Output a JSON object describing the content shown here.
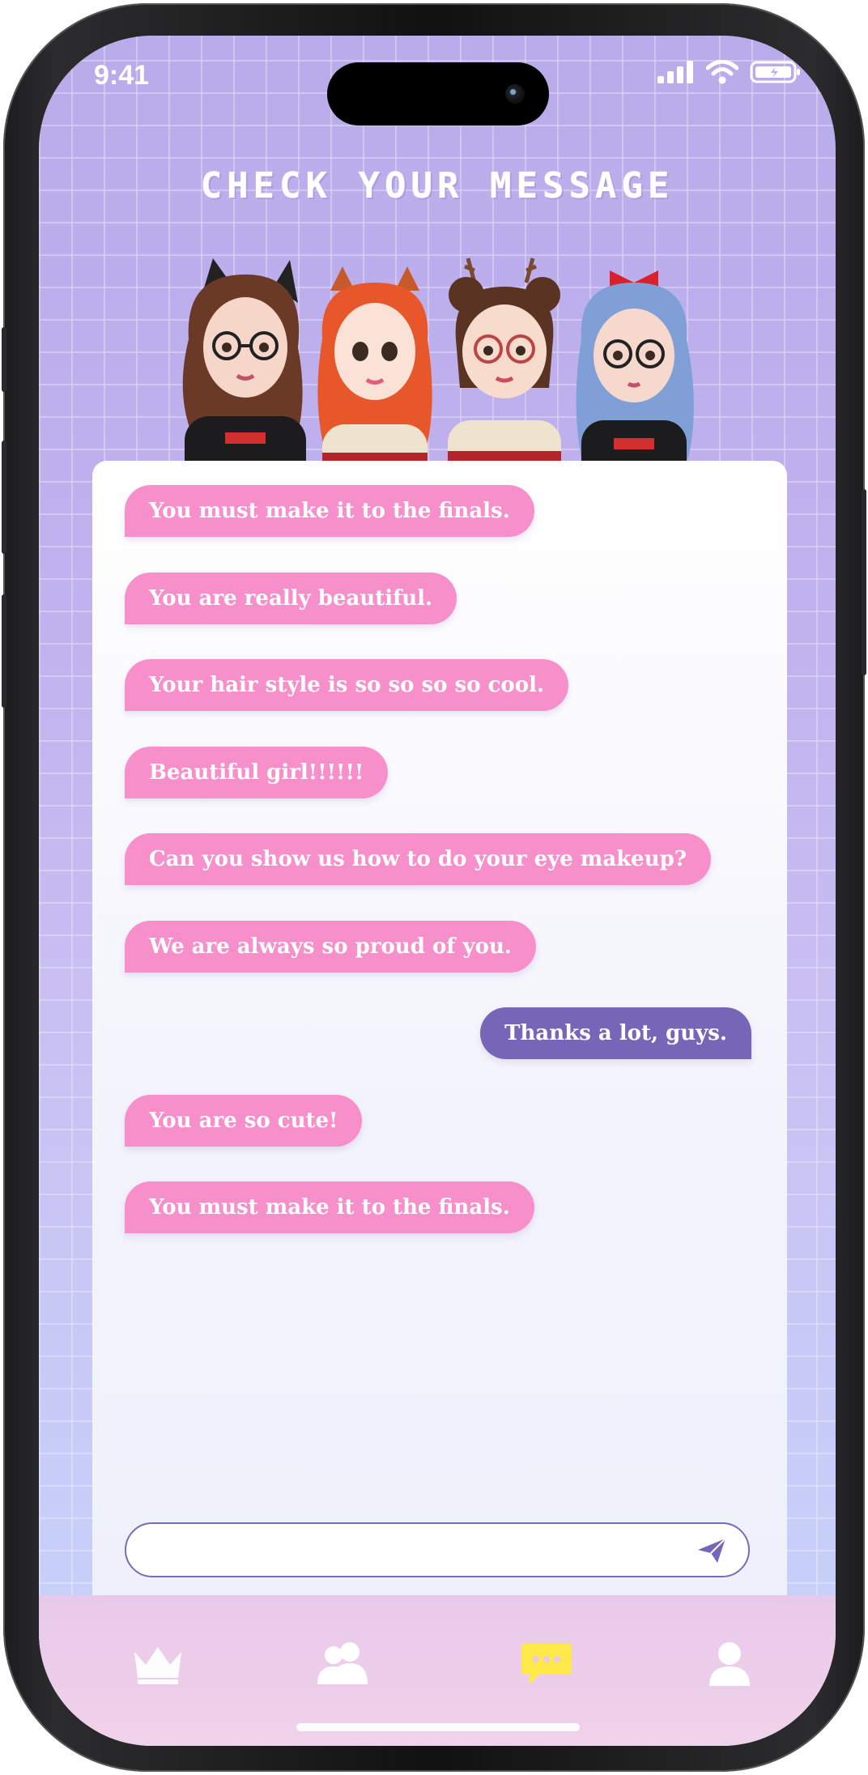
{
  "status_bar": {
    "time": "9:41"
  },
  "header": {
    "title": "CHECK YOUR MESSAGE"
  },
  "avatars": [
    "girl-cat-ears-glasses",
    "girl-fox-ears-red-hair",
    "girl-reindeer-ears-buns",
    "girl-blue-hair-red-bow"
  ],
  "messages": [
    {
      "text": "You must make it to the finals.",
      "direction": "incoming"
    },
    {
      "text": "You are really beautiful.",
      "direction": "incoming"
    },
    {
      "text": "Your hair style is so so so so cool.",
      "direction": "incoming"
    },
    {
      "text": "Beautiful girl!!!!!!",
      "direction": "incoming"
    },
    {
      "text": "Can you show us how to do your eye makeup?",
      "direction": "incoming"
    },
    {
      "text": "We are always so proud of you.",
      "direction": "incoming"
    },
    {
      "text": "Thanks a lot, guys.",
      "direction": "outgoing"
    },
    {
      "text": "You are so cute!",
      "direction": "incoming"
    },
    {
      "text": "You must make it to the finals.",
      "direction": "incoming"
    }
  ],
  "composer": {
    "value": "",
    "send_icon": "paper-plane-icon"
  },
  "tabs": [
    {
      "icon": "crown-icon",
      "active": false
    },
    {
      "icon": "friends-icon",
      "active": false
    },
    {
      "icon": "chat-icon",
      "active": true
    },
    {
      "icon": "profile-icon",
      "active": false
    }
  ],
  "colors": {
    "incoming_bubble": "#f78fcb",
    "outgoing_bubble": "#7566b8",
    "active_tab": "#ffe94a",
    "inactive_tab": "#ffffff"
  }
}
